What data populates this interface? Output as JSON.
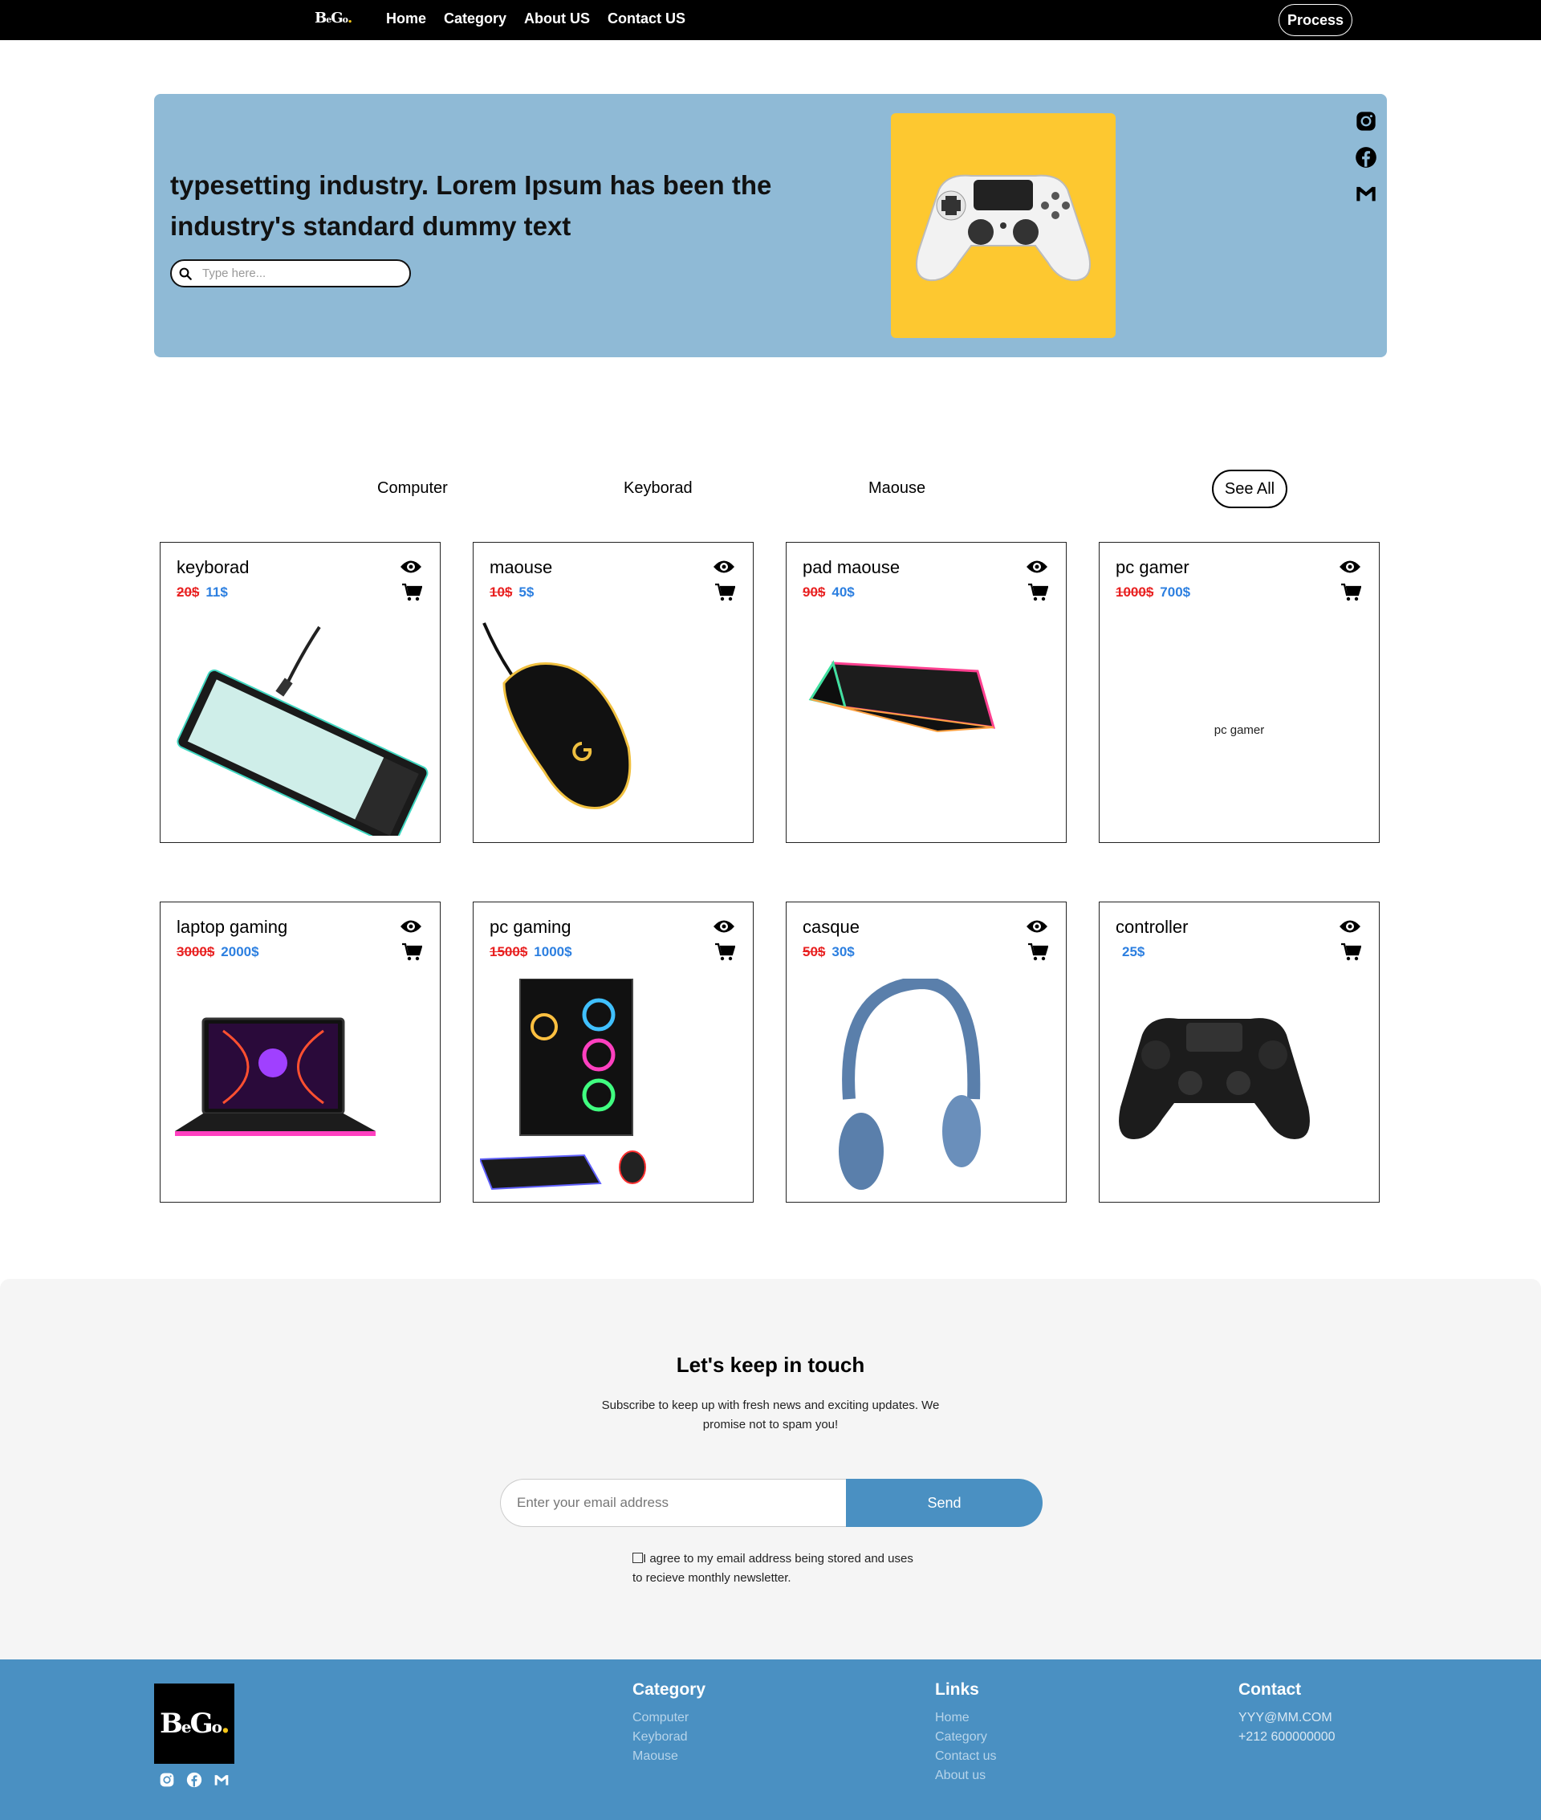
{
  "nav": {
    "logo": {
      "b": "B",
      "e": "e",
      "g": "G",
      "o": "o",
      "dot": "."
    },
    "links": [
      "Home",
      "Category",
      "About US",
      "Contact US"
    ],
    "button": "Process"
  },
  "hero": {
    "title_line1": "typesetting industry. Lorem Ipsum has been the",
    "title_line2": "industry's standard dummy text",
    "search_placeholder": "Type here...",
    "image_bg": "#fdc830"
  },
  "filters": {
    "items": [
      "Computer",
      "Keyborad",
      "Maouse"
    ],
    "see_all": "See All"
  },
  "products": [
    {
      "name": "keyborad",
      "old": "20$",
      "new": "11$"
    },
    {
      "name": "maouse",
      "old": "10$",
      "new": "5$"
    },
    {
      "name": "pad maouse",
      "old": "90$",
      "new": "40$"
    },
    {
      "name": "pc gamer",
      "old": "1000$",
      "new": "700$",
      "alt": "pc gamer"
    },
    {
      "name": "laptop gaming",
      "old": "3000$",
      "new": "2000$"
    },
    {
      "name": "pc gaming",
      "old": "1500$",
      "new": "1000$"
    },
    {
      "name": "casque",
      "old": "50$",
      "new": "30$"
    },
    {
      "name": "controller",
      "old": "",
      "new": "25$"
    }
  ],
  "newsletter": {
    "title": "Let's keep in touch",
    "subtitle": "Subscribe to keep up with fresh news and exciting updates. We promise not to spam you!",
    "email_placeholder": "Enter your email address",
    "send": "Send",
    "consent": "I agree to my email address being stored and uses to recieve monthly newsletter."
  },
  "footer": {
    "category": {
      "title": "Category",
      "items": [
        "Computer",
        "Keyborad",
        "Maouse"
      ]
    },
    "links": {
      "title": "Links",
      "items": [
        "Home",
        "Category",
        "Contact us",
        "About us"
      ]
    },
    "contact": {
      "title": "Contact",
      "email": "YYY@MM.COM",
      "phone": "+212 600000000"
    }
  },
  "colors": {
    "hero_bg": "#8fbad6",
    "accent": "#4a90c2",
    "old_price": "#e82020",
    "new_price": "#2c7fe0"
  },
  "icons": [
    "search-icon",
    "instagram-icon",
    "facebook-icon",
    "gmail-icon",
    "eye-icon",
    "cart-icon"
  ]
}
